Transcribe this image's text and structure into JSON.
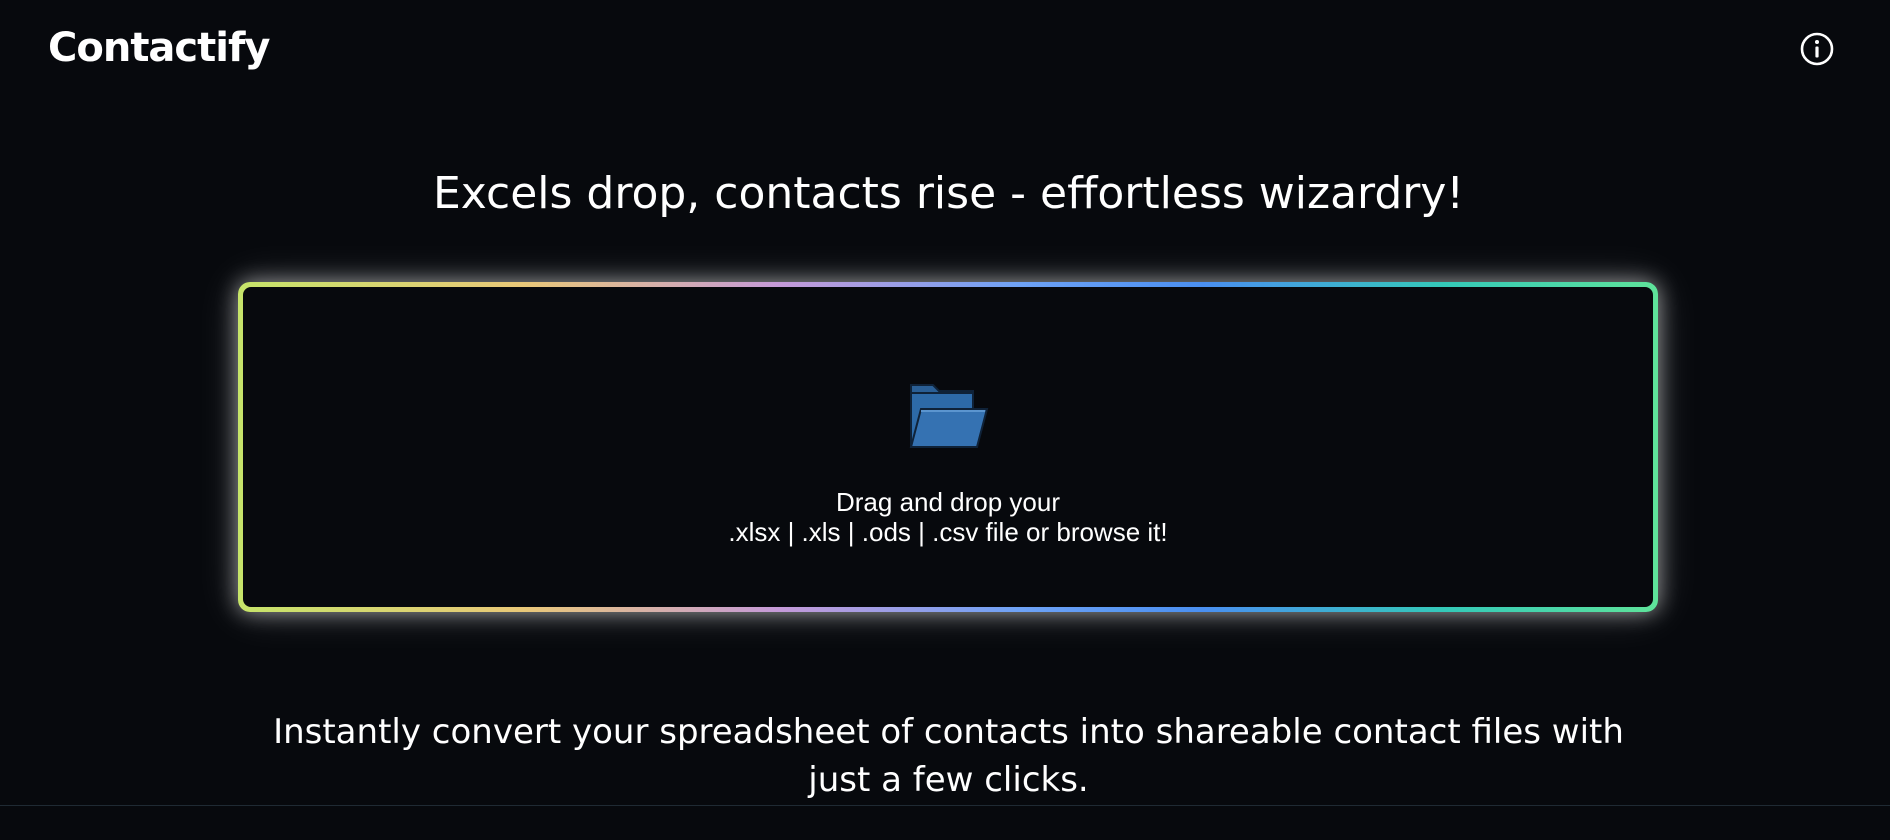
{
  "header": {
    "logo_text": "Contactify",
    "info_icon": "info-icon"
  },
  "main": {
    "headline": "Excels drop, contacts rise - effortless wizardry!",
    "dropzone": {
      "icon": "open-folder-icon",
      "line1": "Drag and drop your",
      "line2": ".xlsx | .xls | .ods | .csv file or browse it!"
    },
    "tagline_line1": "Instantly convert your spreadsheet of contacts into shareable contact files with",
    "tagline_line2": "just a few clicks."
  },
  "colors": {
    "background": "#07090d",
    "text": "#ffffff",
    "gradient": [
      "#c6e46a",
      "#e9c878",
      "#c59ad8",
      "#6ea2f5",
      "#4a8ff0",
      "#34c9b8",
      "#5fe39a"
    ],
    "folder": "#2d6aa8"
  }
}
